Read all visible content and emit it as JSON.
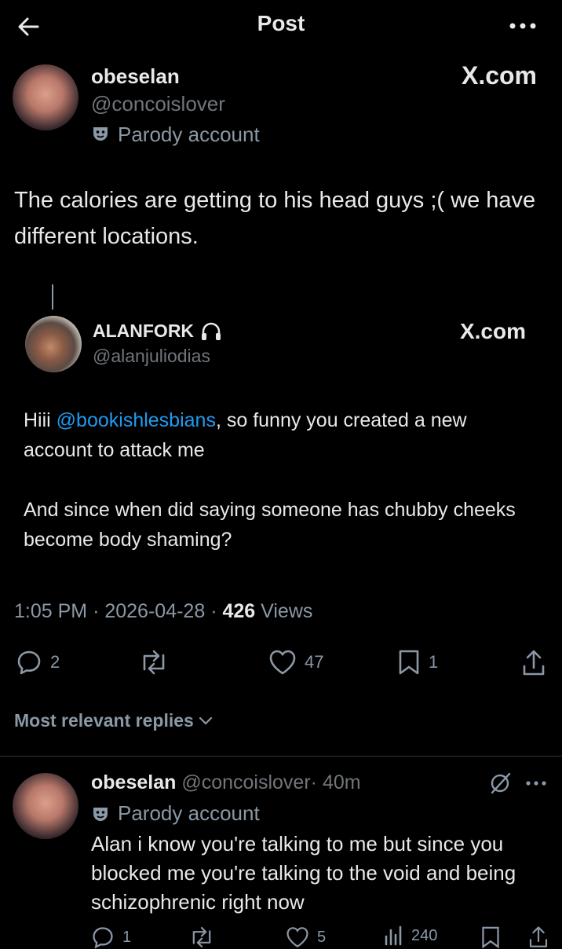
{
  "header": {
    "title": "Post"
  },
  "post": {
    "author": {
      "name": "obeselan",
      "handle": "@concoislover",
      "label": "Parody account",
      "source": "X.com"
    },
    "text": "The calories are getting to his head guys ;( we have different locations.",
    "quote": {
      "name": "ALANFORK",
      "handle": "@alanjuliodias",
      "source": "X.com",
      "line1_prefix": "Hiii ",
      "mention": "@bookishlesbians",
      "line1_suffix": ", so funny you created a new account to attack me",
      "paragraph2": "And since when did saying someone has chubby cheeks become body shaming?"
    },
    "meta": {
      "time": "1:05 PM",
      "date": "2026-04-28",
      "views_count": "426",
      "views_label": "Views",
      "separator": "·"
    },
    "actions": {
      "replies": "2",
      "likes": "47",
      "bookmarks": "1"
    }
  },
  "replies_section": {
    "filter_label": "Most relevant replies"
  },
  "reply": {
    "name": "obeselan",
    "handle": "@concoislover",
    "time": "· 40m",
    "label": "Parody account",
    "text": "Alan i know you're talking to me but since you blocked me you're talking to the void and being schizophrenic right now",
    "actions": {
      "replies": "1",
      "likes": "5",
      "views": "240"
    }
  },
  "icons": [
    "back-arrow-icon",
    "more-icon",
    "parody-mask-icon",
    "headphones-icon",
    "reply-icon",
    "repost-icon",
    "like-icon",
    "bookmark-icon",
    "share-icon",
    "chevron-down-icon",
    "grok-icon",
    "views-icon"
  ],
  "colors": {
    "background": "#000000",
    "text": "#e7e9ea",
    "muted": "#8b98a5",
    "link": "#1d9bf0",
    "divider": "#2f3336"
  }
}
